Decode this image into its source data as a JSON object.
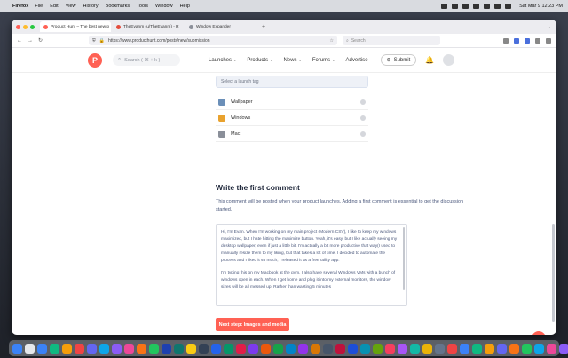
{
  "menubar": {
    "app": "Firefox",
    "items": [
      "File",
      "Edit",
      "View",
      "History",
      "Bookmarks",
      "Tools",
      "Window",
      "Help"
    ],
    "clock": "Sat Mar 9  12:23 PM"
  },
  "tabs": [
    {
      "title": "Product Hunt – The best new p",
      "color": "#ff6154"
    },
    {
      "title": "TheEvanm (u/TheEvanm) - R",
      "color": "#e44c3c"
    },
    {
      "title": "Window Expander",
      "color": "#8b8f99"
    }
  ],
  "urlbar": {
    "url": "https://www.producthunt.com/posts/new/submission",
    "search_placeholder": "Search"
  },
  "ph_header": {
    "logo_letter": "P",
    "search_placeholder": "Search ( ⌘ + k )",
    "nav": [
      "Launches",
      "Products",
      "News",
      "Forums",
      "Advertise"
    ],
    "submit_label": "Submit"
  },
  "launch_tags": {
    "search_placeholder": "Select a launch tag",
    "items": [
      {
        "label": "Wallpaper",
        "color": "#6b8fb8"
      },
      {
        "label": "Windows",
        "color": "#e9a22e"
      },
      {
        "label": "Mac",
        "color": "#8a8f99"
      }
    ]
  },
  "comment": {
    "title": "Write the first comment",
    "description": "This comment will be posted when your product launches. Adding a first comment is essential to get the discussion started.",
    "paragraphs": [
      "Hi, I'm Evan. When I'm working on my main project (Modern CSV), I like to keep my windows maximized, but I hate hitting the maximize button. Yeah, it's easy, but I like actually seeing my desktop wallpaper, even if just a little bit. I'm actually a bit more productive that way(I used to manually resize them to my liking, but that takes a lot of time. I decided to automate the process and I liked it so much, I released it as a free utility app.",
      "I'm typing this on my Macbook at the gym. I also have several Windows VMs with a bunch of windows open in each. When I get home and plug it into my external monitors, the window sizes will be all messed up. Rather than wasting 5 minutes"
    ]
  },
  "next_button": "Next step: Images and media",
  "dock_colors": [
    "#3b82f6",
    "#e5e7eb",
    "#3b82f6",
    "#10b981",
    "#f59e0b",
    "#ef4444",
    "#6366f1",
    "#0ea5e9",
    "#8b5cf6",
    "#ec4899",
    "#f97316",
    "#22c55e",
    "#1e40af",
    "#0f766e",
    "#facc15",
    "#334155",
    "#2563eb",
    "#059669",
    "#e11d48",
    "#7c3aed",
    "#ea580c",
    "#16a34a",
    "#0284c7",
    "#9333ea",
    "#d97706",
    "#475569",
    "#be123c",
    "#1d4ed8",
    "#0891b2",
    "#65a30d",
    "#f43f5e",
    "#a855f7",
    "#14b8a6",
    "#eab308",
    "#64748b",
    "#ef4444",
    "#3b82f6",
    "#10b981",
    "#f59e0b",
    "#6366f1",
    "#f97316",
    "#22c55e",
    "#0ea5e9",
    "#ec4899",
    "#8b5cf6",
    "#e5e7eb",
    "#94a3b8"
  ]
}
